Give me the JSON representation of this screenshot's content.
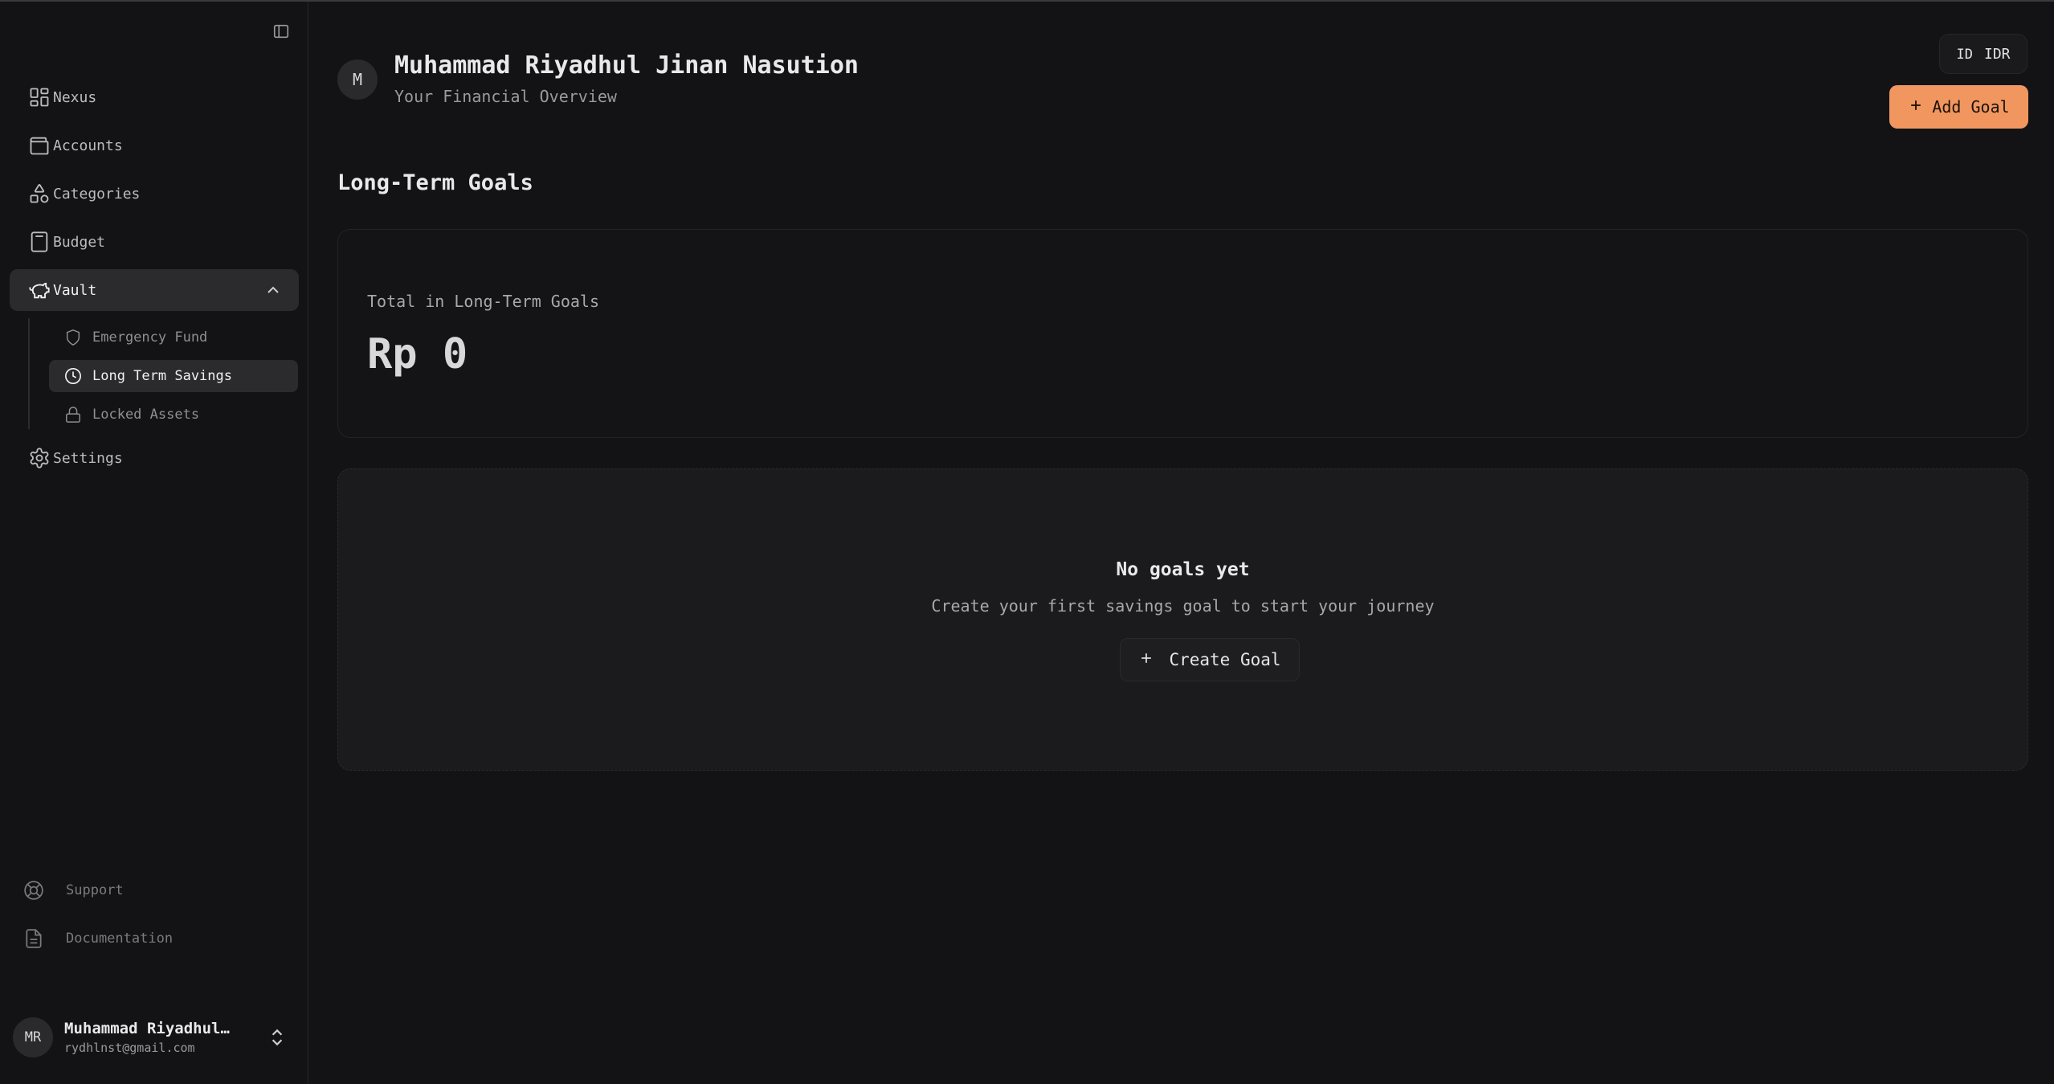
{
  "sidebar": {
    "toggle_icon": "sidebar-panel-icon",
    "items": [
      {
        "label": "Nexus",
        "icon": "grid-icon"
      },
      {
        "label": "Accounts",
        "icon": "wallet-icon"
      },
      {
        "label": "Categories",
        "icon": "shapes-icon"
      },
      {
        "label": "Budget",
        "icon": "calculator-icon"
      },
      {
        "label": "Vault",
        "icon": "piggy-bank-icon",
        "expanded": true
      },
      {
        "label": "Settings",
        "icon": "gear-icon"
      }
    ],
    "vault_subitems": [
      {
        "label": "Emergency Fund",
        "icon": "shield-icon"
      },
      {
        "label": "Long Term Savings",
        "icon": "clock-icon",
        "active": true
      },
      {
        "label": "Locked Assets",
        "icon": "lock-icon"
      }
    ],
    "footer": [
      {
        "label": "Support",
        "icon": "lifebuoy-icon"
      },
      {
        "label": "Documentation",
        "icon": "document-icon"
      }
    ],
    "user": {
      "initials": "MR",
      "name": "Muhammad Riyadhul…",
      "email": "rydhlnst@gmail.com"
    }
  },
  "header": {
    "avatar_initial": "M",
    "name": "Muhammad Riyadhul Jinan Nasution",
    "subtitle": "Your Financial Overview",
    "language": {
      "flag_code": "ID",
      "currency": "IDR"
    },
    "add_goal_label": "Add Goal"
  },
  "main": {
    "section_title": "Long-Term Goals",
    "total_card": {
      "label": "Total in Long-Term Goals",
      "value": "Rp 0"
    },
    "empty_state": {
      "title": "No goals yet",
      "subtitle": "Create your first savings goal to start your journey",
      "button_label": "Create Goal"
    }
  },
  "colors": {
    "background": "#131315",
    "accent": "#f29660",
    "active_item": "#2b2b2e"
  }
}
